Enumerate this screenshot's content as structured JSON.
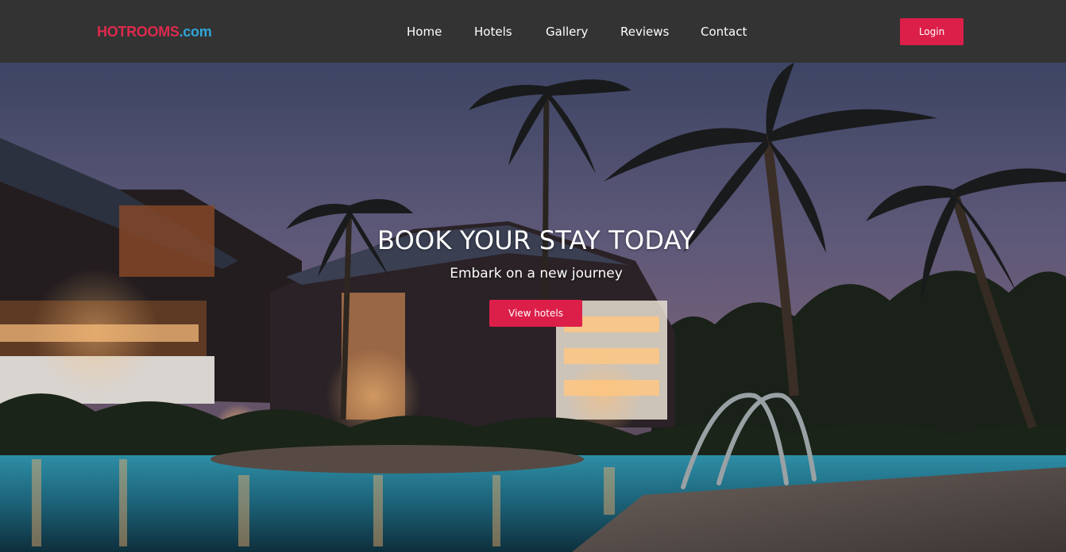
{
  "brand": {
    "part1": "HOTROOMS",
    "part2": ".com"
  },
  "nav": {
    "links": [
      "Home",
      "Hotels",
      "Gallery",
      "Reviews",
      "Contact"
    ],
    "login_label": "Login"
  },
  "hero": {
    "title": "BOOK YOUR STAY TODAY",
    "subtitle": "Embark on a new journey",
    "button_label": "View hotels"
  },
  "colors": {
    "navbar": "#333333",
    "brand_primary": "#dc2a4d",
    "brand_secondary": "#2fa6d8",
    "accent_button": "#dc1f49"
  }
}
